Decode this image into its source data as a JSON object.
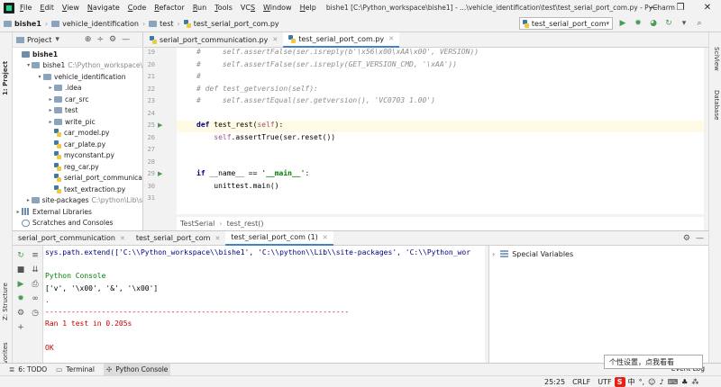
{
  "menubar": {
    "items": [
      "File",
      "Edit",
      "View",
      "Navigate",
      "Code",
      "Refactor",
      "Run",
      "Tools",
      "VCS",
      "Window",
      "Help"
    ],
    "mnemonics": [
      "F",
      "E",
      "V",
      "N",
      "C",
      "R",
      "R",
      "T",
      "S",
      "W",
      "H"
    ],
    "title": "bishe1 [C:\\Python_workspace\\bishe1] - ...\\vehicle_identification\\test\\test_serial_port_com.py - PyCharm"
  },
  "navbar": {
    "crumbs": [
      "bishe1",
      "vehicle_identification",
      "test",
      "test_serial_port_com.py"
    ],
    "run_config": "test_serial_port_com"
  },
  "left_stripe": {
    "project_label": "1: Project",
    "structure_label": "Z: Structure",
    "favorites_label": "2: Favorites"
  },
  "right_stripe": {
    "sciview_label": "SciView",
    "database_label": "Database"
  },
  "project_panel": {
    "header": "Project",
    "tree": [
      {
        "label": "bishe1",
        "path": "",
        "indent": 0,
        "arrow": "",
        "bold": true
      },
      {
        "label": "bishe1",
        "path": "C:\\Python_workspace\\",
        "indent": 1,
        "arrow": "▾"
      },
      {
        "label": "vehicle_identification",
        "path": "",
        "indent": 2,
        "arrow": "▾"
      },
      {
        "label": ".idea",
        "path": "",
        "indent": 3,
        "arrow": "▸"
      },
      {
        "label": "car_src",
        "path": "",
        "indent": 3,
        "arrow": "▸"
      },
      {
        "label": "test",
        "path": "",
        "indent": 3,
        "arrow": "▸"
      },
      {
        "label": "write_pic",
        "path": "",
        "indent": 3,
        "arrow": "▸"
      },
      {
        "label": "car_model.py",
        "path": "",
        "indent": 3,
        "arrow": "",
        "file": true
      },
      {
        "label": "car_plate.py",
        "path": "",
        "indent": 3,
        "arrow": "",
        "file": true
      },
      {
        "label": "myconstant.py",
        "path": "",
        "indent": 3,
        "arrow": "",
        "file": true
      },
      {
        "label": "reg_car.py",
        "path": "",
        "indent": 3,
        "arrow": "",
        "file": true
      },
      {
        "label": "serial_port_communica",
        "path": "",
        "indent": 3,
        "arrow": "",
        "file": true
      },
      {
        "label": "text_extraction.py",
        "path": "",
        "indent": 3,
        "arrow": "",
        "file": true
      },
      {
        "label": "site-packages",
        "path": "C:\\python\\Lib\\s",
        "indent": 1,
        "arrow": "▸"
      },
      {
        "label": "External Libraries",
        "path": "",
        "indent": 0,
        "arrow": "▸",
        "lib": true
      },
      {
        "label": "Scratches and Consoles",
        "path": "",
        "indent": 0,
        "arrow": "",
        "scratch": true
      }
    ]
  },
  "editor": {
    "tabs": [
      {
        "label": "serial_port_communication.py",
        "active": false
      },
      {
        "label": "test_serial_port_com.py",
        "active": true
      }
    ],
    "line_numbers": [
      "19",
      "20",
      "21",
      "22",
      "23",
      "24",
      "25",
      "26",
      "27",
      "28",
      "29",
      "30",
      "31"
    ],
    "lines": [
      "#     self.assertFalse(ser.isreply(b'\\x56\\x00\\xAA\\x00', VERSION))",
      "#     self.assertFalse(ser.isreply(GET_VERSION_CMD, '\\xAA'))",
      "#",
      "# def test_getversion(self):",
      "#     self.assertEqual(ser.getversion(), 'VC0703 1.00')",
      "",
      "def test_rest(self):",
      "    self.assertTrue(ser.reset())",
      "",
      "",
      "if __name__ == '__main__':",
      "    unittest.main()",
      ""
    ],
    "breadcrumbs": [
      "TestSerial",
      "test_rest()"
    ]
  },
  "console": {
    "tabs": [
      {
        "label": "serial_port_communication",
        "active": false
      },
      {
        "label": "test_serial_port_com",
        "active": false
      },
      {
        "label": "test_serial_port_com (1)",
        "active": true
      }
    ],
    "lines": [
      {
        "text": "sys.path.extend(['C:\\\\Python_workspace\\\\bishe1', 'C:\\\\python\\\\Lib\\\\site-packages', 'C:\\\\Python_wor",
        "color": "#000080"
      },
      {
        "text": "",
        "color": "#000"
      },
      {
        "text": "Python Console",
        "color": "#008000"
      },
      {
        "text": "['v', '\\x00', '&', '\\x00']",
        "color": "#000"
      },
      {
        "text": ".",
        "color": "#c00000"
      },
      {
        "text": "----------------------------------------------------------------------",
        "color": "#c00000"
      },
      {
        "text": "Ran 1 test in 0.205s",
        "color": "#c00000"
      },
      {
        "text": "",
        "color": "#000"
      },
      {
        "text": "OK",
        "color": "#c00000"
      }
    ],
    "special_variables": "Special Variables"
  },
  "bottom_tools": [
    {
      "label": "6: TODO",
      "active": false
    },
    {
      "label": "Terminal",
      "active": false
    },
    {
      "label": "Python Console",
      "active": true
    }
  ],
  "status": {
    "position": "25:25",
    "line_sep": "CRLF",
    "encoding": "UTF",
    "event_log": "Event Log",
    "ime_tip": "个性设置，点我看看"
  },
  "colors": {
    "accent": "#4083c9",
    "current_line": "#fffae3",
    "run_green": "#499c54"
  }
}
